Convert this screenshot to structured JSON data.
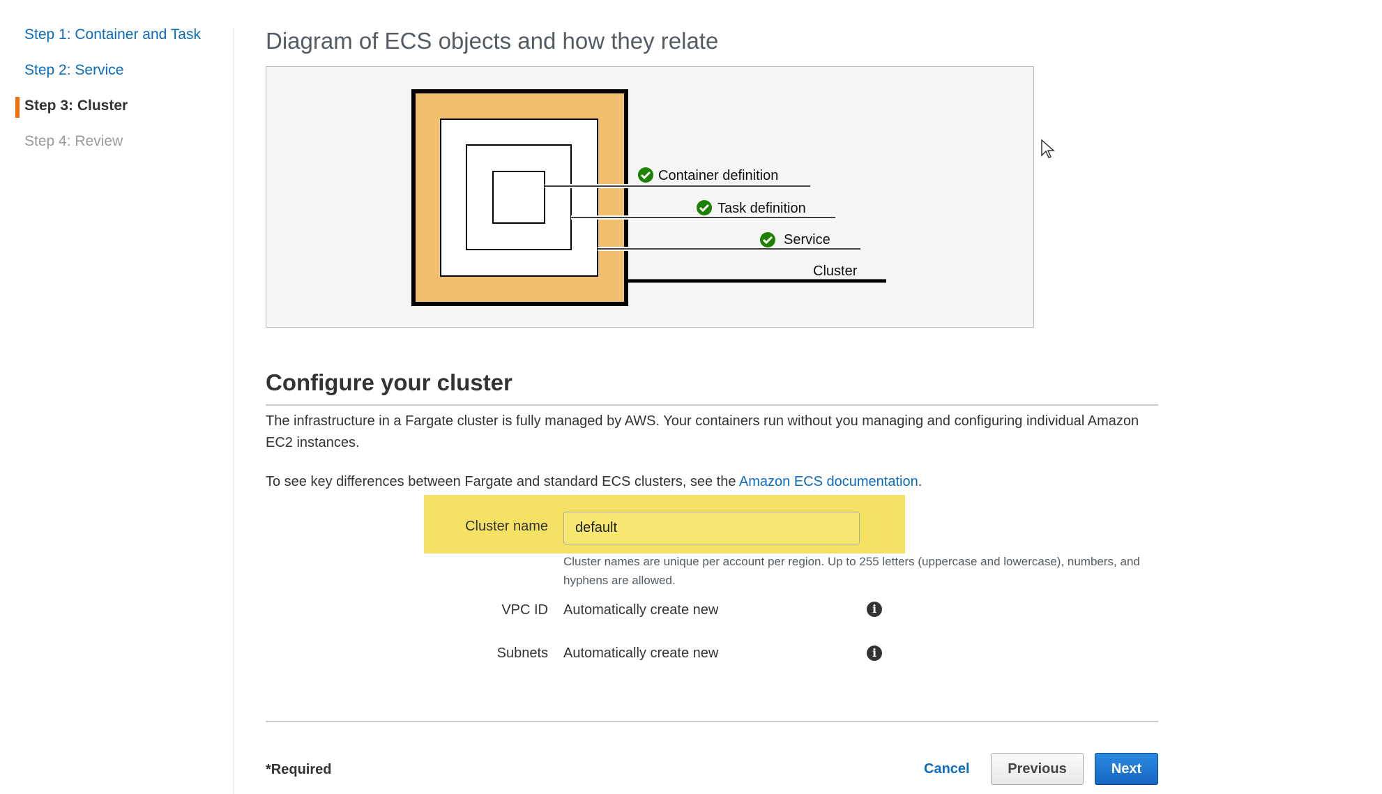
{
  "sidebar": {
    "steps": [
      {
        "label": "Step 1: Container and Task",
        "state": "link"
      },
      {
        "label": "Step 2: Service",
        "state": "link"
      },
      {
        "label": "Step 3: Cluster",
        "state": "active"
      },
      {
        "label": "Step 4: Review",
        "state": "disabled"
      }
    ]
  },
  "diagram": {
    "title": "Diagram of ECS objects and how they relate",
    "labels": {
      "container_definition": "Container definition",
      "task_definition": "Task definition",
      "service": "Service",
      "cluster": "Cluster"
    },
    "check_icon": "check-circle-icon"
  },
  "config": {
    "title": "Configure your cluster",
    "para1": "The infrastructure in a Fargate cluster is fully managed by AWS. Your containers run without you managing and configuring individual Amazon EC2 instances.",
    "para2_prefix": "To see key differences between Fargate and standard ECS clusters, see the ",
    "para2_link": "Amazon ECS documentation",
    "para2_suffix": ".",
    "cluster_name_label": "Cluster name",
    "cluster_name_value": "default",
    "cluster_name_help": "Cluster names are unique per account per region. Up to 255 letters (uppercase and lowercase), numbers, and hyphens are allowed.",
    "vpc_label": "VPC ID",
    "vpc_value": "Automatically create new",
    "subnets_label": "Subnets",
    "subnets_value": "Automatically create new",
    "info_icon": "info-icon"
  },
  "footer": {
    "required": "*Required",
    "cancel": "Cancel",
    "previous": "Previous",
    "next": "Next"
  },
  "colors": {
    "accent_link": "#0b6cbd",
    "active_step_bar": "#ec7211",
    "highlight": "#f5e265",
    "diagram_cluster_fill": "#f2bf6e",
    "check_green": "#1d8102",
    "primary_button": "#1766c2"
  }
}
